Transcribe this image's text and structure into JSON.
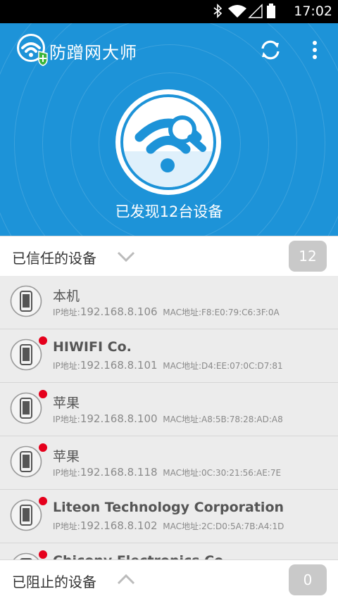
{
  "status_bar": {
    "time": "17:02"
  },
  "app": {
    "title": "防蹭网大师"
  },
  "hero": {
    "found_text": "已发现12台设备"
  },
  "trusted_section": {
    "title": "已信任的设备",
    "count": "12"
  },
  "devices": [
    {
      "name": "本机",
      "ip_label": "IP地址:",
      "ip": "192.168.8.106",
      "mac": "MAC地址:F8:E0:79:C6:3F:0A",
      "alert": false
    },
    {
      "name": "HIWIFI Co.",
      "ip_label": "IP地址:",
      "ip": "192.168.8.101",
      "mac": "MAC地址:D4:EE:07:0C:D7:81",
      "alert": true
    },
    {
      "name": "苹果",
      "ip_label": "IP地址:",
      "ip": "192.168.8.100",
      "mac": "MAC地址:A8:5B:78:28:AD:A8",
      "alert": true
    },
    {
      "name": "苹果",
      "ip_label": "IP地址:",
      "ip": "192.168.8.118",
      "mac": "MAC地址:0C:30:21:56:AE:7E",
      "alert": true
    },
    {
      "name": "Liteon Technology Corporation",
      "ip_label": "IP地址:",
      "ip": "192.168.8.102",
      "mac": "MAC地址:2C:D0:5A:7B:A4:1D",
      "alert": true
    },
    {
      "name": "Chicony Electronics Co.",
      "ip_label": "",
      "ip": "",
      "mac": "",
      "alert": true
    }
  ],
  "blocked_section": {
    "title": "已阻止的设备",
    "count": "0"
  },
  "colors": {
    "primary_blue": "#1d93d8",
    "alert_red": "#e5001c",
    "badge_gray": "#c9c9c9"
  }
}
